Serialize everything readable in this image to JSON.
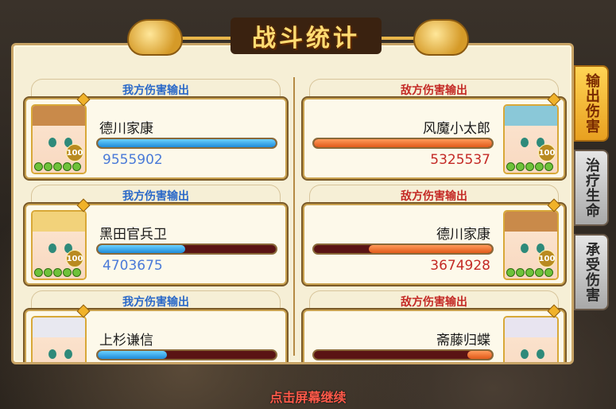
{
  "title": "战斗统计",
  "tabs": [
    {
      "label": "输出伤害",
      "active": true
    },
    {
      "label": "治疗生命",
      "active": false
    },
    {
      "label": "承受伤害",
      "active": false
    }
  ],
  "ally_header": "我方伤害输出",
  "enemy_header": "敌方伤害输出",
  "ally": [
    {
      "name": "德川家康",
      "value": "9555902",
      "fraction": 1.0,
      "level": "100",
      "hair": "#c98a4a"
    },
    {
      "name": "黑田官兵卫",
      "value": "4703675",
      "fraction": 0.49,
      "level": "100",
      "hair": "#f2d27a"
    },
    {
      "name": "上杉谦信",
      "value": "",
      "fraction": 0.39,
      "level": "",
      "hair": "#e8e8f0"
    }
  ],
  "enemy": [
    {
      "name": "风魔小太郎",
      "value": "5325537",
      "fraction": 1.0,
      "level": "100",
      "hair": "#8ac8d8"
    },
    {
      "name": "德川家康",
      "value": "3674928",
      "fraction": 0.69,
      "level": "100",
      "hair": "#c98a4a"
    },
    {
      "name": "斋藤归蝶",
      "value": "",
      "fraction": 0.14,
      "level": "",
      "hair": "#e8e4f0"
    }
  ],
  "footer": "点击屏幕继续"
}
